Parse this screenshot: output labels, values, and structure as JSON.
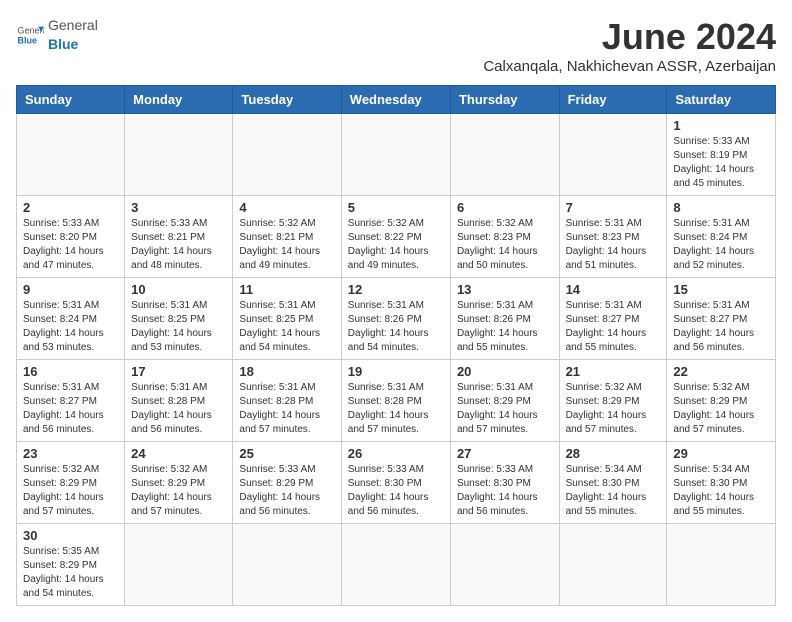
{
  "header": {
    "logo_general": "General",
    "logo_blue": "Blue",
    "month_title": "June 2024",
    "subtitle": "Calxanqala, Nakhichevan ASSR, Azerbaijan"
  },
  "weekdays": [
    "Sunday",
    "Monday",
    "Tuesday",
    "Wednesday",
    "Thursday",
    "Friday",
    "Saturday"
  ],
  "weeks": [
    [
      {
        "day": "",
        "info": ""
      },
      {
        "day": "",
        "info": ""
      },
      {
        "day": "",
        "info": ""
      },
      {
        "day": "",
        "info": ""
      },
      {
        "day": "",
        "info": ""
      },
      {
        "day": "",
        "info": ""
      },
      {
        "day": "1",
        "info": "Sunrise: 5:33 AM\nSunset: 8:19 PM\nDaylight: 14 hours\nand 45 minutes."
      }
    ],
    [
      {
        "day": "2",
        "info": "Sunrise: 5:33 AM\nSunset: 8:20 PM\nDaylight: 14 hours\nand 47 minutes."
      },
      {
        "day": "3",
        "info": "Sunrise: 5:33 AM\nSunset: 8:21 PM\nDaylight: 14 hours\nand 48 minutes."
      },
      {
        "day": "4",
        "info": "Sunrise: 5:32 AM\nSunset: 8:21 PM\nDaylight: 14 hours\nand 49 minutes."
      },
      {
        "day": "5",
        "info": "Sunrise: 5:32 AM\nSunset: 8:22 PM\nDaylight: 14 hours\nand 49 minutes."
      },
      {
        "day": "6",
        "info": "Sunrise: 5:32 AM\nSunset: 8:23 PM\nDaylight: 14 hours\nand 50 minutes."
      },
      {
        "day": "7",
        "info": "Sunrise: 5:31 AM\nSunset: 8:23 PM\nDaylight: 14 hours\nand 51 minutes."
      },
      {
        "day": "8",
        "info": "Sunrise: 5:31 AM\nSunset: 8:24 PM\nDaylight: 14 hours\nand 52 minutes."
      }
    ],
    [
      {
        "day": "9",
        "info": "Sunrise: 5:31 AM\nSunset: 8:24 PM\nDaylight: 14 hours\nand 53 minutes."
      },
      {
        "day": "10",
        "info": "Sunrise: 5:31 AM\nSunset: 8:25 PM\nDaylight: 14 hours\nand 53 minutes."
      },
      {
        "day": "11",
        "info": "Sunrise: 5:31 AM\nSunset: 8:25 PM\nDaylight: 14 hours\nand 54 minutes."
      },
      {
        "day": "12",
        "info": "Sunrise: 5:31 AM\nSunset: 8:26 PM\nDaylight: 14 hours\nand 54 minutes."
      },
      {
        "day": "13",
        "info": "Sunrise: 5:31 AM\nSunset: 8:26 PM\nDaylight: 14 hours\nand 55 minutes."
      },
      {
        "day": "14",
        "info": "Sunrise: 5:31 AM\nSunset: 8:27 PM\nDaylight: 14 hours\nand 55 minutes."
      },
      {
        "day": "15",
        "info": "Sunrise: 5:31 AM\nSunset: 8:27 PM\nDaylight: 14 hours\nand 56 minutes."
      }
    ],
    [
      {
        "day": "16",
        "info": "Sunrise: 5:31 AM\nSunset: 8:27 PM\nDaylight: 14 hours\nand 56 minutes."
      },
      {
        "day": "17",
        "info": "Sunrise: 5:31 AM\nSunset: 8:28 PM\nDaylight: 14 hours\nand 56 minutes."
      },
      {
        "day": "18",
        "info": "Sunrise: 5:31 AM\nSunset: 8:28 PM\nDaylight: 14 hours\nand 57 minutes."
      },
      {
        "day": "19",
        "info": "Sunrise: 5:31 AM\nSunset: 8:28 PM\nDaylight: 14 hours\nand 57 minutes."
      },
      {
        "day": "20",
        "info": "Sunrise: 5:31 AM\nSunset: 8:29 PM\nDaylight: 14 hours\nand 57 minutes."
      },
      {
        "day": "21",
        "info": "Sunrise: 5:32 AM\nSunset: 8:29 PM\nDaylight: 14 hours\nand 57 minutes."
      },
      {
        "day": "22",
        "info": "Sunrise: 5:32 AM\nSunset: 8:29 PM\nDaylight: 14 hours\nand 57 minutes."
      }
    ],
    [
      {
        "day": "23",
        "info": "Sunrise: 5:32 AM\nSunset: 8:29 PM\nDaylight: 14 hours\nand 57 minutes."
      },
      {
        "day": "24",
        "info": "Sunrise: 5:32 AM\nSunset: 8:29 PM\nDaylight: 14 hours\nand 57 minutes."
      },
      {
        "day": "25",
        "info": "Sunrise: 5:33 AM\nSunset: 8:29 PM\nDaylight: 14 hours\nand 56 minutes."
      },
      {
        "day": "26",
        "info": "Sunrise: 5:33 AM\nSunset: 8:30 PM\nDaylight: 14 hours\nand 56 minutes."
      },
      {
        "day": "27",
        "info": "Sunrise: 5:33 AM\nSunset: 8:30 PM\nDaylight: 14 hours\nand 56 minutes."
      },
      {
        "day": "28",
        "info": "Sunrise: 5:34 AM\nSunset: 8:30 PM\nDaylight: 14 hours\nand 55 minutes."
      },
      {
        "day": "29",
        "info": "Sunrise: 5:34 AM\nSunset: 8:30 PM\nDaylight: 14 hours\nand 55 minutes."
      }
    ],
    [
      {
        "day": "30",
        "info": "Sunrise: 5:35 AM\nSunset: 8:29 PM\nDaylight: 14 hours\nand 54 minutes."
      },
      {
        "day": "",
        "info": ""
      },
      {
        "day": "",
        "info": ""
      },
      {
        "day": "",
        "info": ""
      },
      {
        "day": "",
        "info": ""
      },
      {
        "day": "",
        "info": ""
      },
      {
        "day": "",
        "info": ""
      }
    ]
  ]
}
